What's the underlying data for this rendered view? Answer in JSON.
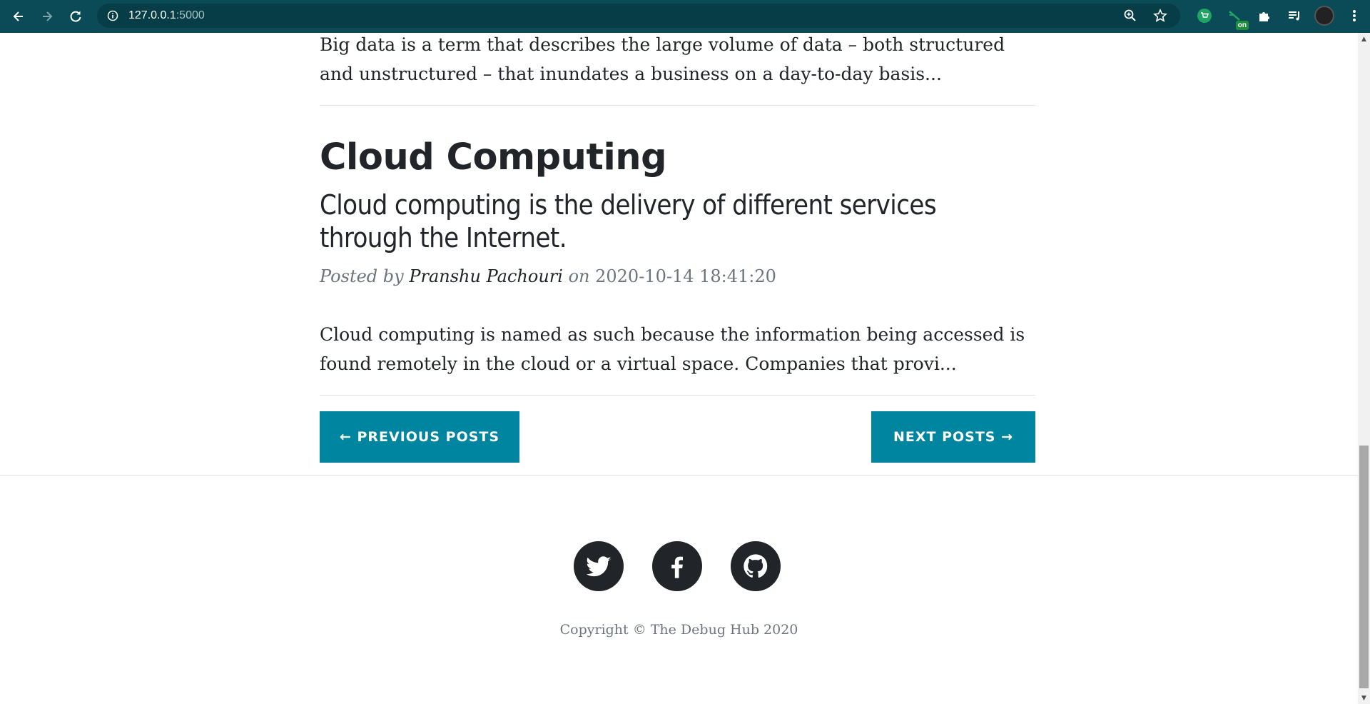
{
  "browser": {
    "url_host": "127.0.0.1",
    "url_port": ":5000",
    "ext_badge": "on",
    "colors": {
      "chrome": "#0b4a57",
      "omnibox": "#063d47"
    }
  },
  "posts": [
    {
      "excerpt_line1": "Big data is a term that describes the large volume of data – both structured",
      "excerpt_line2": "and unstructured – that inundates a business on a day-to-day basis..."
    },
    {
      "title": "Cloud Computing",
      "subtitle_line1": "Cloud computing is the delivery of different services",
      "subtitle_line2": "through the Internet.",
      "meta_posted_by": "Posted by",
      "author": "Pranshu Pachouri",
      "meta_on": "on",
      "date": "2020-10-14 18:41:20",
      "excerpt_line1": "Cloud computing is named as such because the information being accessed is",
      "excerpt_line2": "found remotely in the cloud or a virtual space. Companies that provi..."
    }
  ],
  "pager": {
    "prev_label": "← Previous Posts",
    "next_label": "Next Posts →",
    "button_color": "#0085a1"
  },
  "footer": {
    "social": [
      "twitter-icon",
      "facebook-icon",
      "github-icon"
    ],
    "copyright": "Copyright © The Debug Hub 2020"
  }
}
